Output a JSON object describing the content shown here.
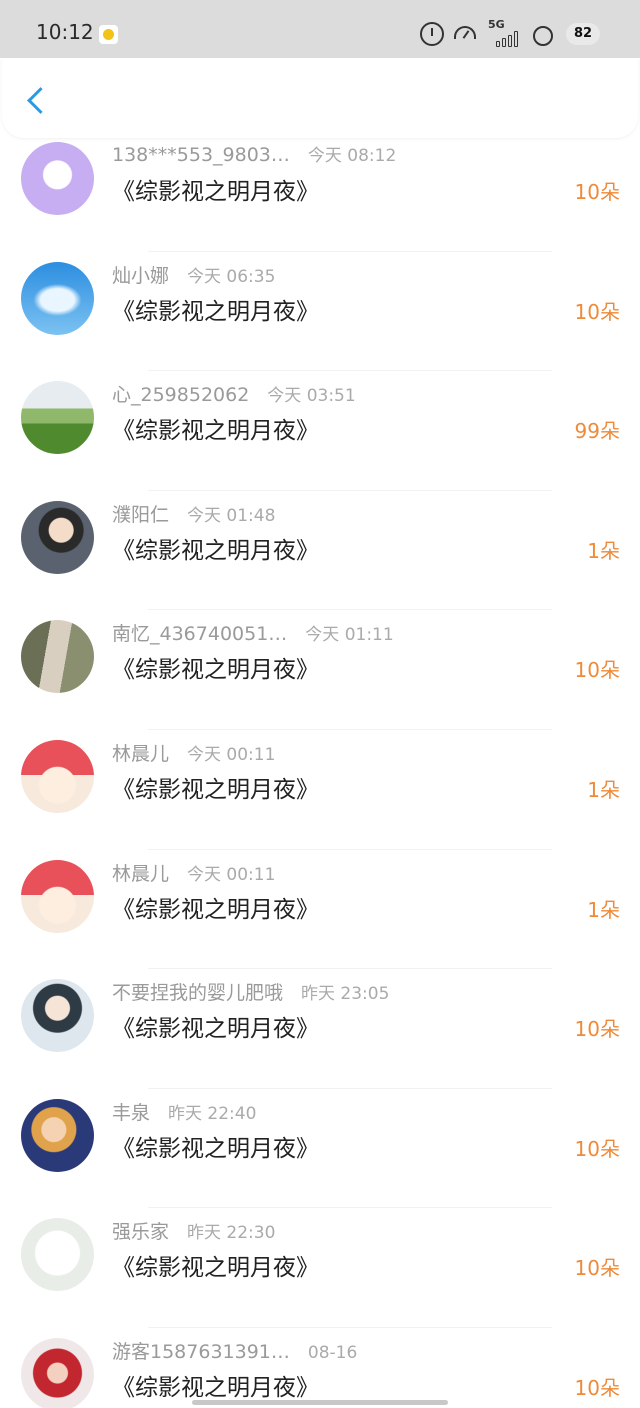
{
  "status": {
    "time": "10:12",
    "network": "5G",
    "battery": "82"
  },
  "list": [
    {
      "name": "138***553_9803…",
      "time": "今天 08:12",
      "title": "《综影视之明月夜》",
      "amount": "10朵",
      "avatar": "chat-bubble-avatar"
    },
    {
      "name": "灿小娜",
      "time": "今天 06:35",
      "title": "《综影视之明月夜》",
      "amount": "10朵",
      "avatar": "sky-cloud-avatar"
    },
    {
      "name": "心_259852062",
      "time": "今天 03:51",
      "title": "《综影视之明月夜》",
      "amount": "99朵",
      "avatar": "landscape-avatar"
    },
    {
      "name": "濮阳仁",
      "time": "今天 01:48",
      "title": "《综影视之明月夜》",
      "amount": "1朵",
      "avatar": "person-photo-avatar"
    },
    {
      "name": "南忆_436740051…",
      "time": "今天 01:11",
      "title": "《综影视之明月夜》",
      "amount": "10朵",
      "avatar": "portrait-photo-avatar"
    },
    {
      "name": "林晨儿",
      "time": "今天 00:11",
      "title": "《综影视之明月夜》",
      "amount": "1朵",
      "avatar": "cartoon-girl-avatar"
    },
    {
      "name": "林晨儿",
      "time": "今天 00:11",
      "title": "《综影视之明月夜》",
      "amount": "1朵",
      "avatar": "cartoon-girl-avatar"
    },
    {
      "name": "不要捏我的婴儿肥哦",
      "time": "昨天 23:05",
      "title": "《综影视之明月夜》",
      "amount": "10朵",
      "avatar": "anime-girl-avatar"
    },
    {
      "name": "丰泉",
      "time": "昨天 22:40",
      "title": "《综影视之明月夜》",
      "amount": "10朵",
      "avatar": "anime-boy-avatar"
    },
    {
      "name": "强乐家",
      "time": "昨天 22:30",
      "title": "《综影视之明月夜》",
      "amount": "10朵",
      "avatar": "flower-avatar"
    },
    {
      "name": "游客1587631391…",
      "time": "08-16",
      "title": "《综影视之明月夜》",
      "amount": "10朵",
      "avatar": "red-child-avatar"
    }
  ],
  "colors": {
    "accent_blue": "#2a9be3",
    "amount_orange": "#ee8a38",
    "name_gray": "#9a9a9a",
    "title_black": "#222222"
  }
}
